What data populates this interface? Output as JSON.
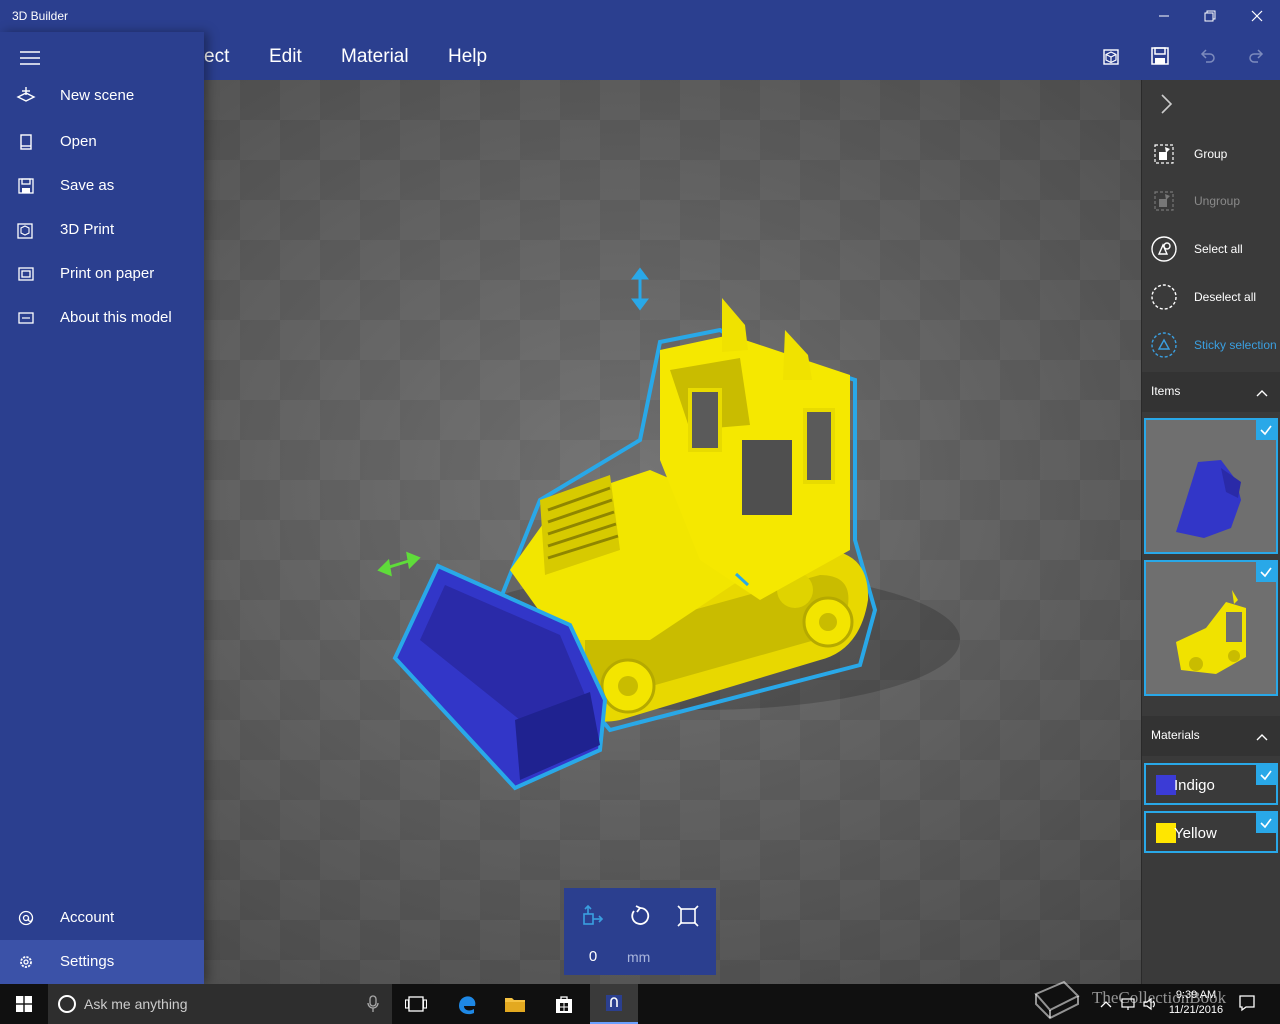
{
  "app": {
    "title": "3D Builder"
  },
  "window_controls": {
    "minimize": "minimize-icon",
    "restore": "restore-icon",
    "close": "close-icon"
  },
  "menubar": {
    "obscured_tab": "ect",
    "tabs": [
      "Edit",
      "Material",
      "Help"
    ]
  },
  "toolbar": {
    "icons": [
      "3d-view-icon",
      "save-icon",
      "undo-icon",
      "redo-icon"
    ]
  },
  "drawer": {
    "items": [
      {
        "label": "New scene",
        "icon": "new-scene-icon"
      },
      {
        "label": "Open",
        "icon": "open-icon"
      },
      {
        "label": "Save as",
        "icon": "save-as-icon"
      },
      {
        "label": "3D Print",
        "icon": "3d-print-icon"
      },
      {
        "label": "Print on paper",
        "icon": "print-icon"
      },
      {
        "label": "About this model",
        "icon": "info-icon"
      }
    ],
    "bottom_items": [
      {
        "label": "Account",
        "icon": "account-icon"
      },
      {
        "label": "Settings",
        "icon": "gear-icon",
        "selected": true
      }
    ]
  },
  "transform": {
    "value": "0",
    "unit": "mm"
  },
  "rightpanel": {
    "actions": [
      {
        "label": "Group",
        "state": "normal"
      },
      {
        "label": "Ungroup",
        "state": "disabled"
      },
      {
        "label": "Select all",
        "state": "normal"
      },
      {
        "label": "Deselect all",
        "state": "normal"
      },
      {
        "label": "Sticky selection",
        "state": "accent"
      }
    ],
    "items_header": "Items",
    "materials_header": "Materials",
    "materials": [
      {
        "label": "Indigo",
        "color": "#3b3bd6"
      },
      {
        "label": "Yellow",
        "color": "#ffe600"
      }
    ]
  },
  "colors": {
    "accent": "#2b3f8f",
    "selection": "#29a8e8",
    "model_yellow": "#f0e400",
    "model_indigo": "#3236c8"
  },
  "taskbar": {
    "search_placeholder": "Ask me anything",
    "time": "9:39 AM",
    "date": "11/21/2016",
    "watermark": "TheCollectionBook"
  }
}
